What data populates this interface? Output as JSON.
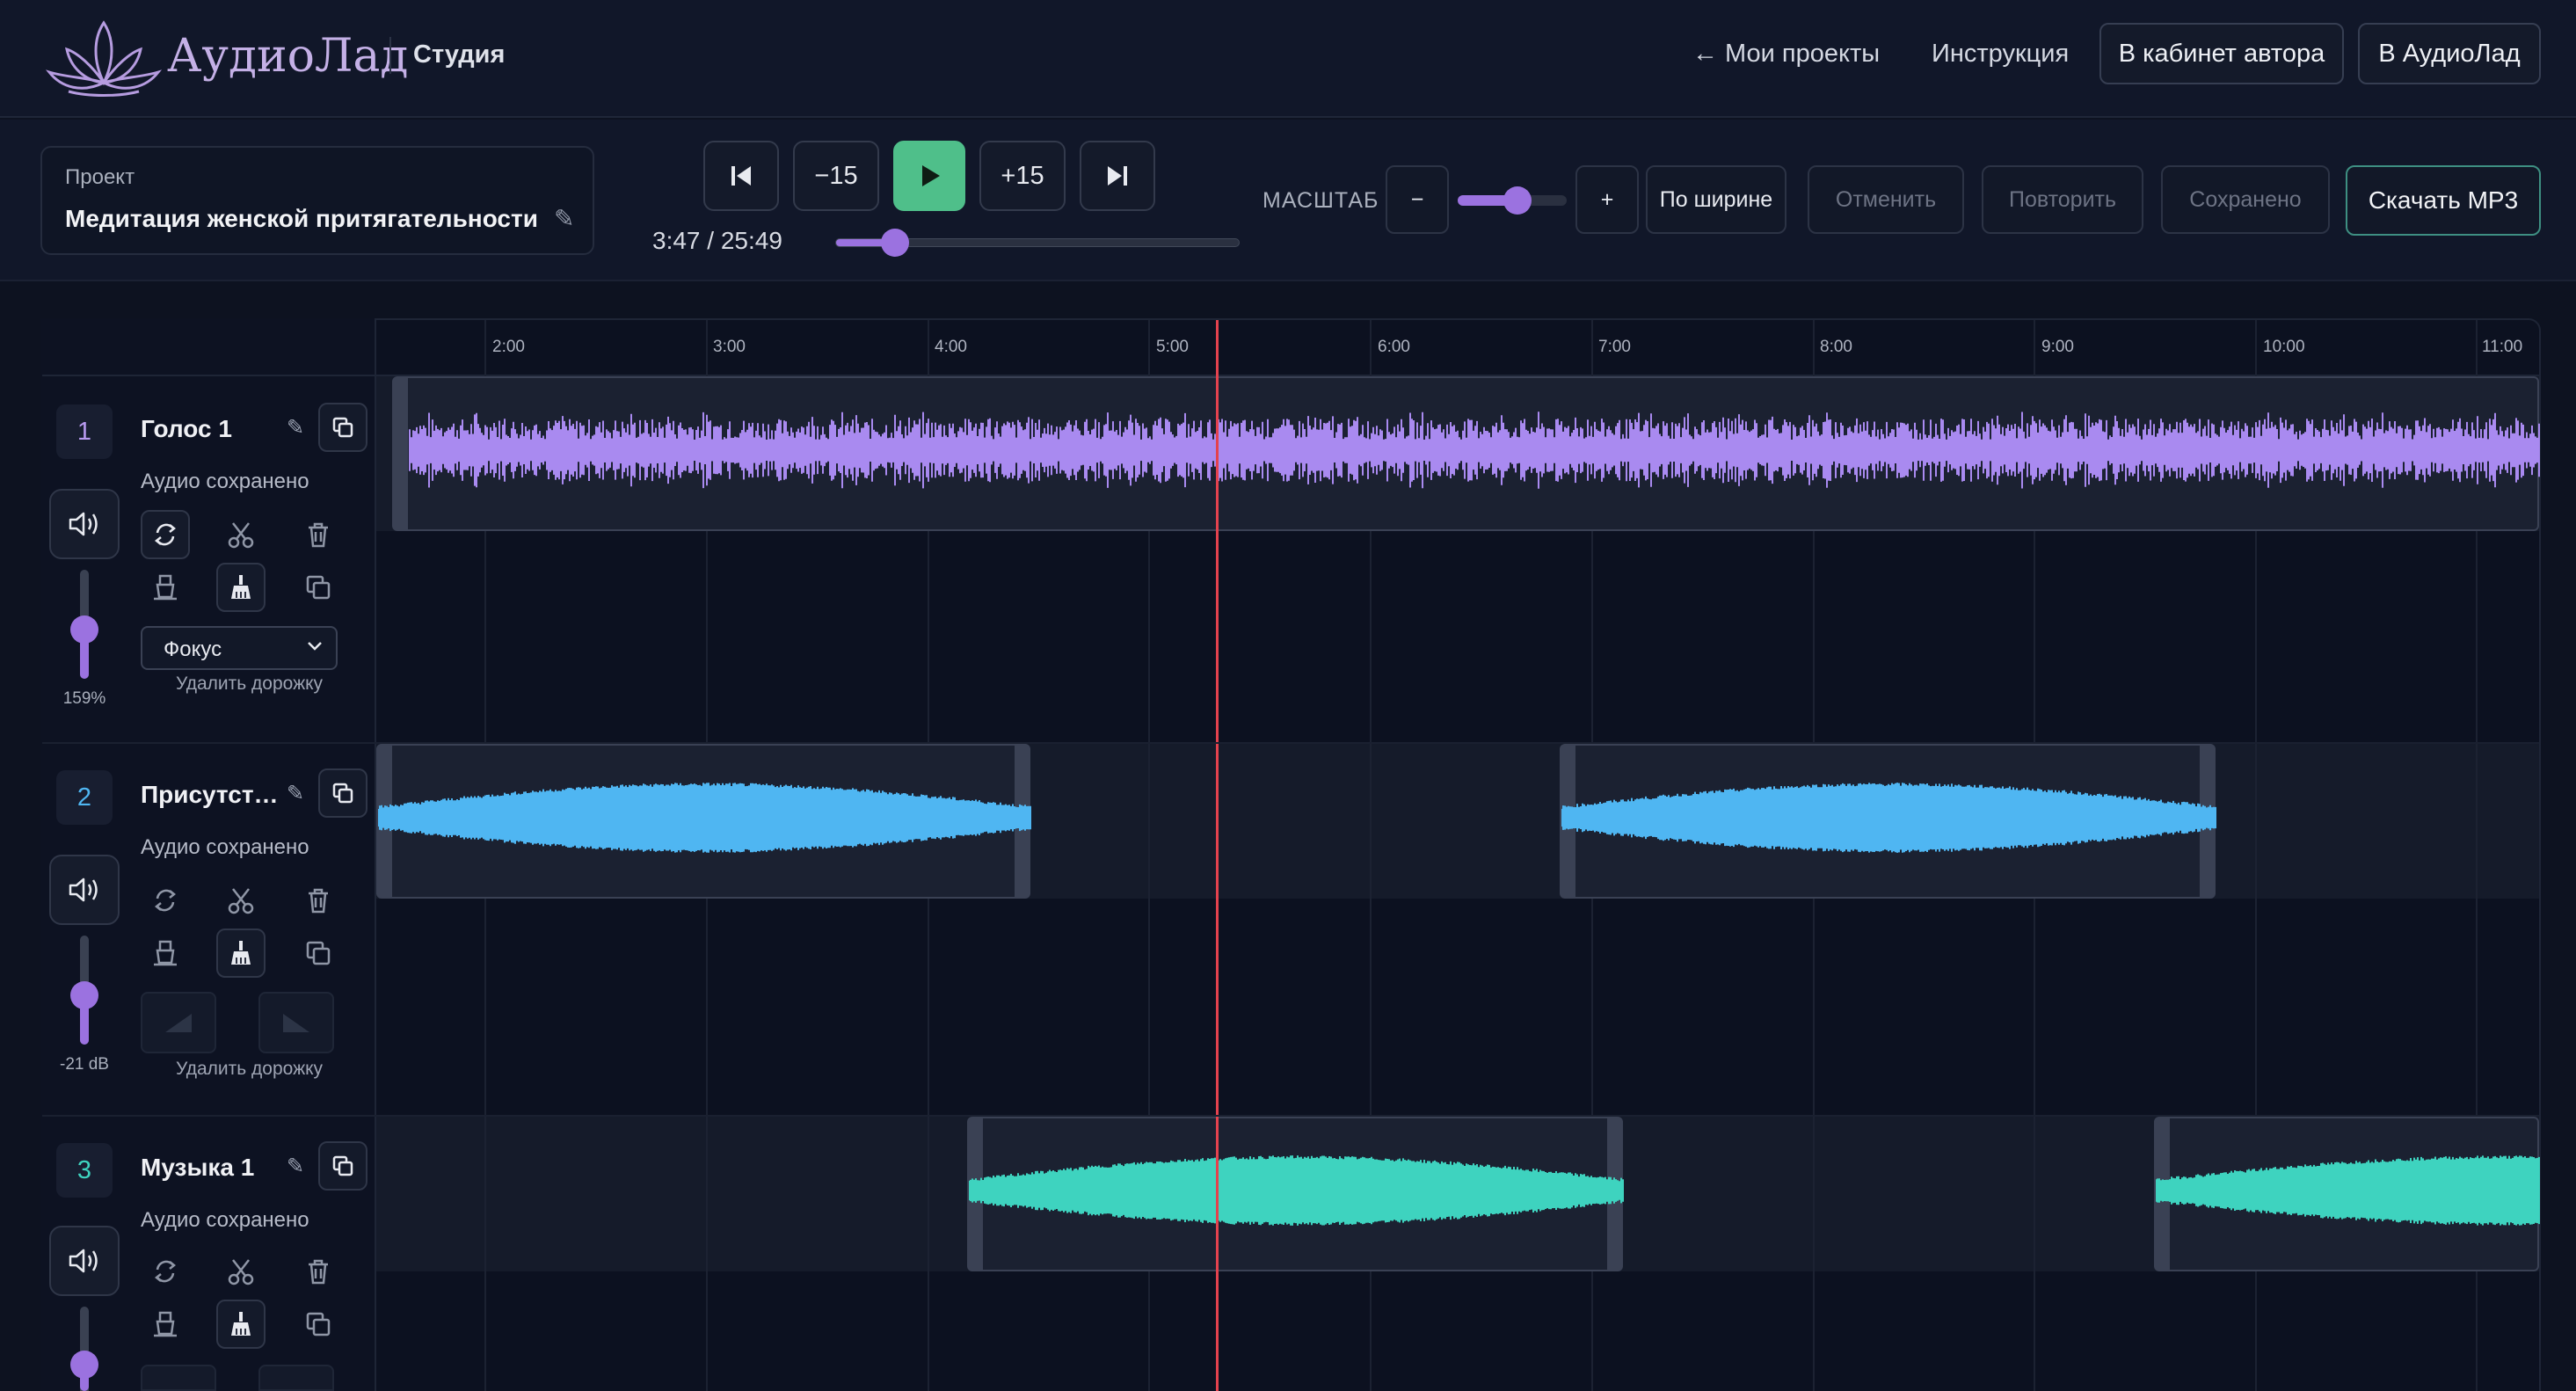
{
  "header": {
    "brand": "АудиоЛад",
    "section": "Студия",
    "nav_projects": "← Мои проекты",
    "nav_help": "Инструкция",
    "btn_cabinet": "В кабинет автора",
    "btn_audiolad": "В АудиоЛад"
  },
  "project": {
    "label": "Проект",
    "name": "Медитация женской притягательности"
  },
  "transport": {
    "back15": "−15",
    "fwd15": "+15",
    "time": "3:47 / 25:49",
    "progress": 0.147
  },
  "toolbar": {
    "zoom_label": "МАСШТАБ",
    "zoom_minus": "−",
    "zoom_plus": "+",
    "zoom_level": 0.55,
    "fit": "По ширине",
    "undo": "Отменить",
    "redo": "Повторить",
    "saved": "Сохранено",
    "download": "Скачать MP3"
  },
  "timeline": {
    "ticks": [
      "2:00",
      "3:00",
      "4:00",
      "5:00",
      "6:00",
      "7:00",
      "8:00",
      "9:00",
      "10:00",
      "11:00"
    ]
  },
  "tracks": [
    {
      "number": "1",
      "name": "Голос 1",
      "status": "Аудио сохранено",
      "volume_label": "159%",
      "volume_level": 0.45,
      "mode": "Фокус",
      "delete": "Удалить дорожку",
      "color": "#a98af0"
    },
    {
      "number": "2",
      "name": "Присутст…",
      "status": "Аудио сохранено",
      "volume_label": "-21 dB",
      "volume_level": 0.45,
      "delete": "Удалить дорожку",
      "color": "#4fb6f2"
    },
    {
      "number": "3",
      "name": "Музыка 1",
      "status": "Аудио сохранено",
      "color": "#3ed3bf"
    }
  ],
  "colors": {
    "accent": "#9b72e0",
    "play": "#4fbf8a",
    "playhead": "#e4424e",
    "download_border": "#3e8f82"
  }
}
